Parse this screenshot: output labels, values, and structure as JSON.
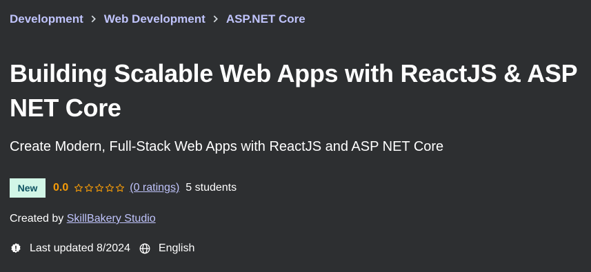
{
  "breadcrumb": [
    "Development",
    "Web Development",
    "ASP.NET Core"
  ],
  "course": {
    "title": "Building Scalable Web Apps with ReactJS & ASP NET Core",
    "subtitle": "Create Modern, Full-Stack Web Apps with ReactJS and ASP NET Core",
    "badge": "New",
    "rating": "0.0",
    "rating_stars_filled": 0,
    "rating_stars_total": 5,
    "ratings_count_text": "(0 ratings)",
    "students_text": "5 students",
    "created_by_prefix": "Created by",
    "instructor": "SkillBakery Studio",
    "last_updated": "Last updated 8/2024",
    "language": "English"
  },
  "colors": {
    "background": "#2d2f31",
    "link": "#c0c4fc",
    "rating": "#f69c08",
    "badge_bg": "#d2f6e7",
    "badge_text": "#0d5261"
  },
  "icons": {
    "breadcrumb_separator": "chevron-right-icon",
    "star": "star-outline-icon",
    "updated": "alert-badge-icon",
    "language": "globe-icon"
  }
}
